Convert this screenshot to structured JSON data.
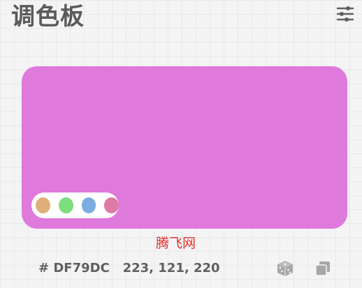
{
  "header": {
    "title": "调色板"
  },
  "color": {
    "hex_value": "# DF79DC",
    "rgb_value": "223, 121, 220",
    "swatch_color": "#DF79DC"
  },
  "palette": {
    "dots": [
      {
        "color": "#E0B07A"
      },
      {
        "color": "#7EDD7E"
      },
      {
        "color": "#7AADE0"
      },
      {
        "color": "#DE7AA6"
      }
    ]
  },
  "watermark": {
    "text": "腾飞网"
  },
  "icons": {
    "settings": "sliders-icon",
    "random": "dice-icon",
    "copy": "copy-icon"
  },
  "colors": {
    "background": "#F4F4F4",
    "text": "#5A5A5A",
    "icon": "#A6A6A6",
    "watermark": "#E03030"
  }
}
